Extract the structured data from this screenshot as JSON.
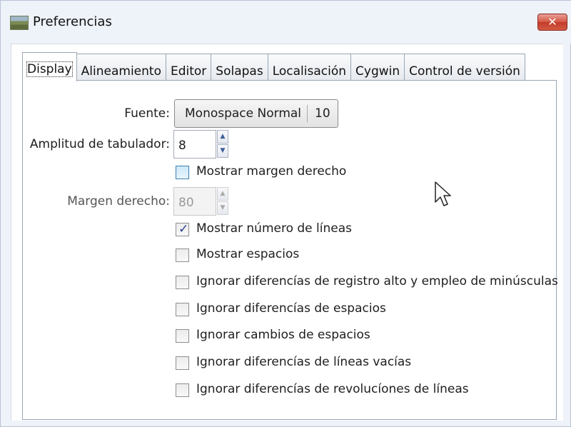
{
  "window": {
    "title": "Preferencias",
    "close_label": "✕",
    "app_icon": "landscape-icon"
  },
  "tabs": [
    {
      "label": "Display",
      "active": true
    },
    {
      "label": "Alineamiento"
    },
    {
      "label": "Editor"
    },
    {
      "label": "Solapas"
    },
    {
      "label": "Localisación"
    },
    {
      "label": "Cygwin"
    },
    {
      "label": "Control de versión"
    }
  ],
  "display": {
    "font_label": "Fuente:",
    "font_name": "Monospace Normal",
    "font_size": "10",
    "tab_width_label": "Amplitud de tabulador:",
    "tab_width_value": "8",
    "show_right_margin_label": "Mostrar margen derecho",
    "right_margin_label": "Margen derecho:",
    "right_margin_value": "80",
    "checkboxes": [
      {
        "label": "Mostrar número de líneas",
        "checked": true
      },
      {
        "label": "Mostrar espacios",
        "checked": false
      },
      {
        "label": "Ignorar diferencías de registro alto y empleo de minúsculas",
        "checked": false
      },
      {
        "label": "Ignorar diferencías de espacios",
        "checked": false
      },
      {
        "label": "Ignorar cambios de espacios",
        "checked": false
      },
      {
        "label": "Ignorar diferencías de líneas vacías",
        "checked": false
      },
      {
        "label": "Ignorar diferencías de revolucíones de líneas",
        "checked": false
      }
    ]
  }
}
